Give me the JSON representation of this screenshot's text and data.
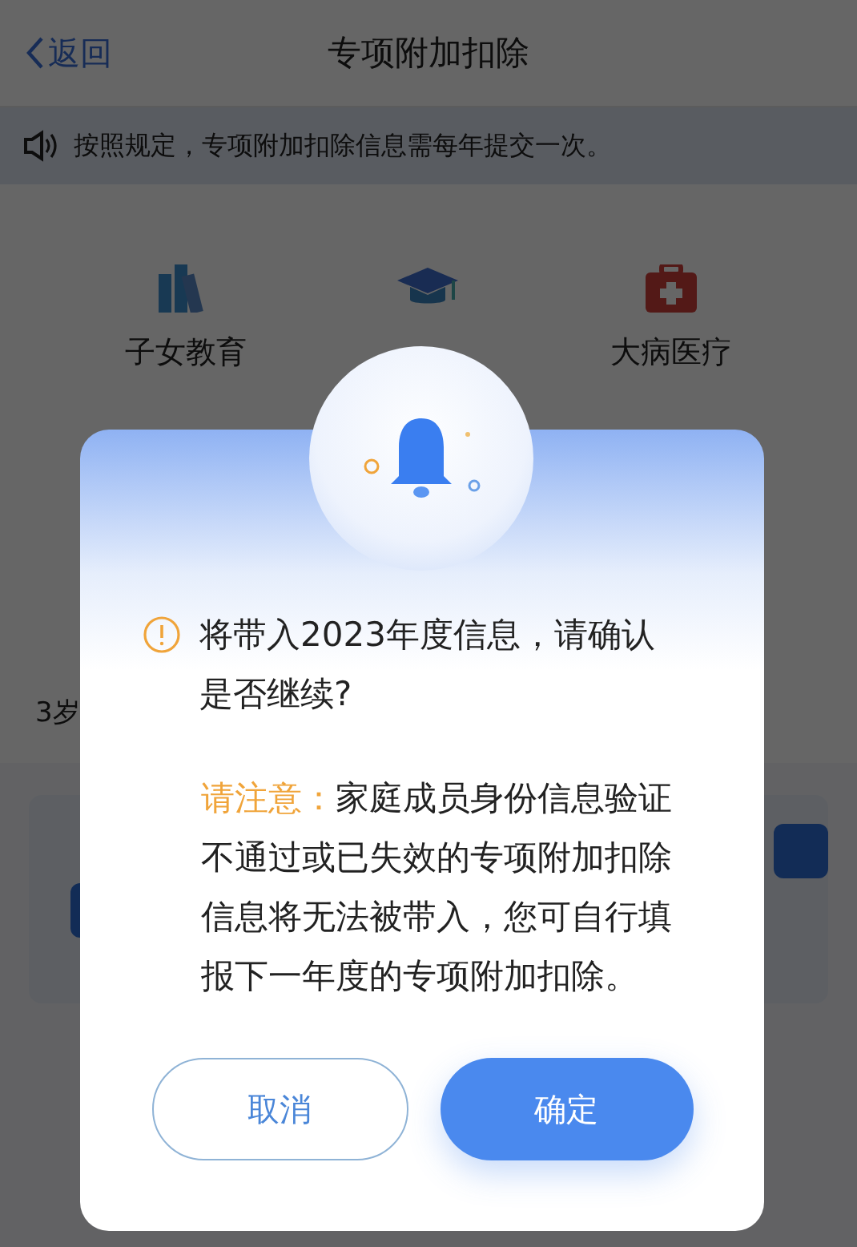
{
  "header": {
    "back_label": "返回",
    "title": "专项附加扣除"
  },
  "notice": "按照规定，专项附加扣除信息需每年提交一次。",
  "categories": [
    {
      "label": "子女教育",
      "kind": "books"
    },
    {
      "kind": "cap"
    },
    {
      "label": "大病医疗",
      "kind": "medkit"
    }
  ],
  "partial_text": "3岁",
  "dialog": {
    "message": "将带入2023年度信息，请确认是否继续?",
    "note_label": "请注意：",
    "note": "家庭成员身份信息验证不通过或已失效的专项附加扣除信息将无法被带入，您可自行填报下一年度的专项附加扣除。",
    "buttons": [
      {
        "label": "取消",
        "kind": "secondary"
      },
      {
        "label": "确定",
        "kind": "primary"
      }
    ]
  }
}
